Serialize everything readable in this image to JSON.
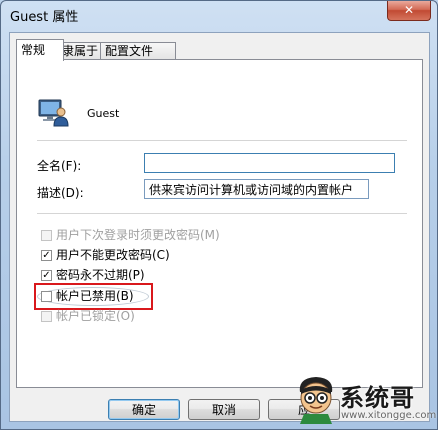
{
  "window": {
    "title": "Guest 属性",
    "close_glyph": "✕"
  },
  "tabs": [
    {
      "label": "常规",
      "active": true
    },
    {
      "label": "隶属于",
      "active": false
    },
    {
      "label": "配置文件",
      "active": false
    }
  ],
  "user": {
    "icon": "user-monitor-icon",
    "name": "Guest"
  },
  "fields": {
    "full_name_label": "全名(F):",
    "full_name_value": "",
    "description_label": "描述(D):",
    "description_value": "供来宾访问计算机或访问域的内置帐户"
  },
  "checkboxes": [
    {
      "label": "用户下次登录时须更改密码(M)",
      "checked": false,
      "enabled": false
    },
    {
      "label": "用户不能更改密码(C)",
      "checked": true,
      "enabled": true
    },
    {
      "label": "密码永不过期(P)",
      "checked": true,
      "enabled": true
    },
    {
      "label": "帐户已禁用(B)",
      "checked": false,
      "enabled": true
    },
    {
      "label": "帐户已锁定(O)",
      "checked": false,
      "enabled": false
    }
  ],
  "buttons": {
    "ok": "确定",
    "cancel": "取消",
    "apply": "应"
  },
  "watermark": {
    "brand": "系统哥",
    "url": "www.xitongge.com"
  },
  "colors": {
    "highlight_box": "#d9181c",
    "focus_border": "#3c7fb1"
  }
}
